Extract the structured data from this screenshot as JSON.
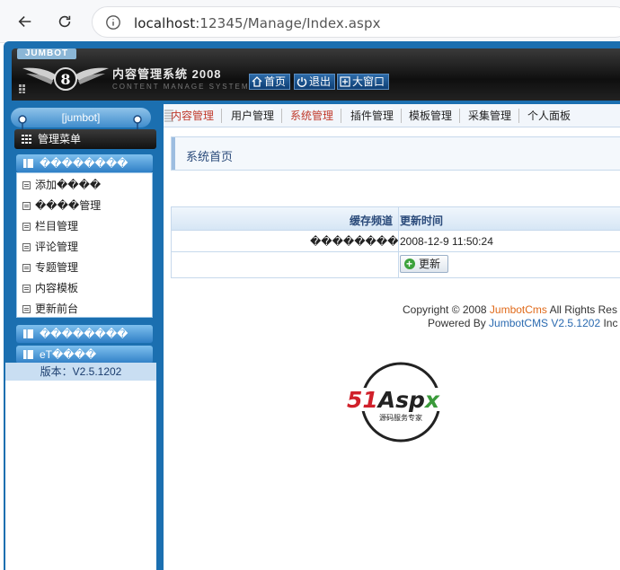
{
  "browser": {
    "url_host": "localhost",
    "url_path": ":12345/Manage/Index.aspx"
  },
  "header": {
    "brand": "JUMBOT",
    "system_title": "内容管理系统 2008",
    "system_subtitle": "CONTENT MANAGE SYSTEM",
    "buttons": {
      "home": "首页",
      "logout": "退出",
      "maximize": "大窗口"
    }
  },
  "sidebar": {
    "user": "[jumbot]",
    "menu_title": "管理菜单",
    "group1": "��������",
    "items": [
      "添加����",
      "����管理",
      "栏目管理",
      "评论管理",
      "专题管理",
      "内容模板",
      "更新前台"
    ],
    "group2": "��������",
    "group3": "eT����",
    "version": "版本：V2.5.1202"
  },
  "tabs": [
    "内容管理",
    "用户管理",
    "系统管理",
    "插件管理",
    "模板管理",
    "采集管理",
    "个人面板"
  ],
  "active_tab": "系统管理",
  "main": {
    "breadcrumb": "系统首页",
    "table": {
      "col1": "缓存频道",
      "col2": "更新时间",
      "row_label": "��������",
      "row_time": "2008-12-9 11:50:24",
      "refresh_label": "更新"
    },
    "copyright_prefix": "Copyright © 2008 ",
    "copyright_brand": "JumbotCms",
    "copyright_suffix": " All Rights Res",
    "powered_prefix": "Powered By ",
    "powered_brand": "JumbotCMS V2.5.1202",
    "powered_suffix": " Inc",
    "logo_text": "51Aspx",
    "logo_tagline": "源码服务专家"
  },
  "colors": {
    "frame_blue": "#1b6fb0",
    "active_tab": "#c0392b",
    "brand_orange": "#e06a1a",
    "link_blue": "#2a6ab0"
  }
}
